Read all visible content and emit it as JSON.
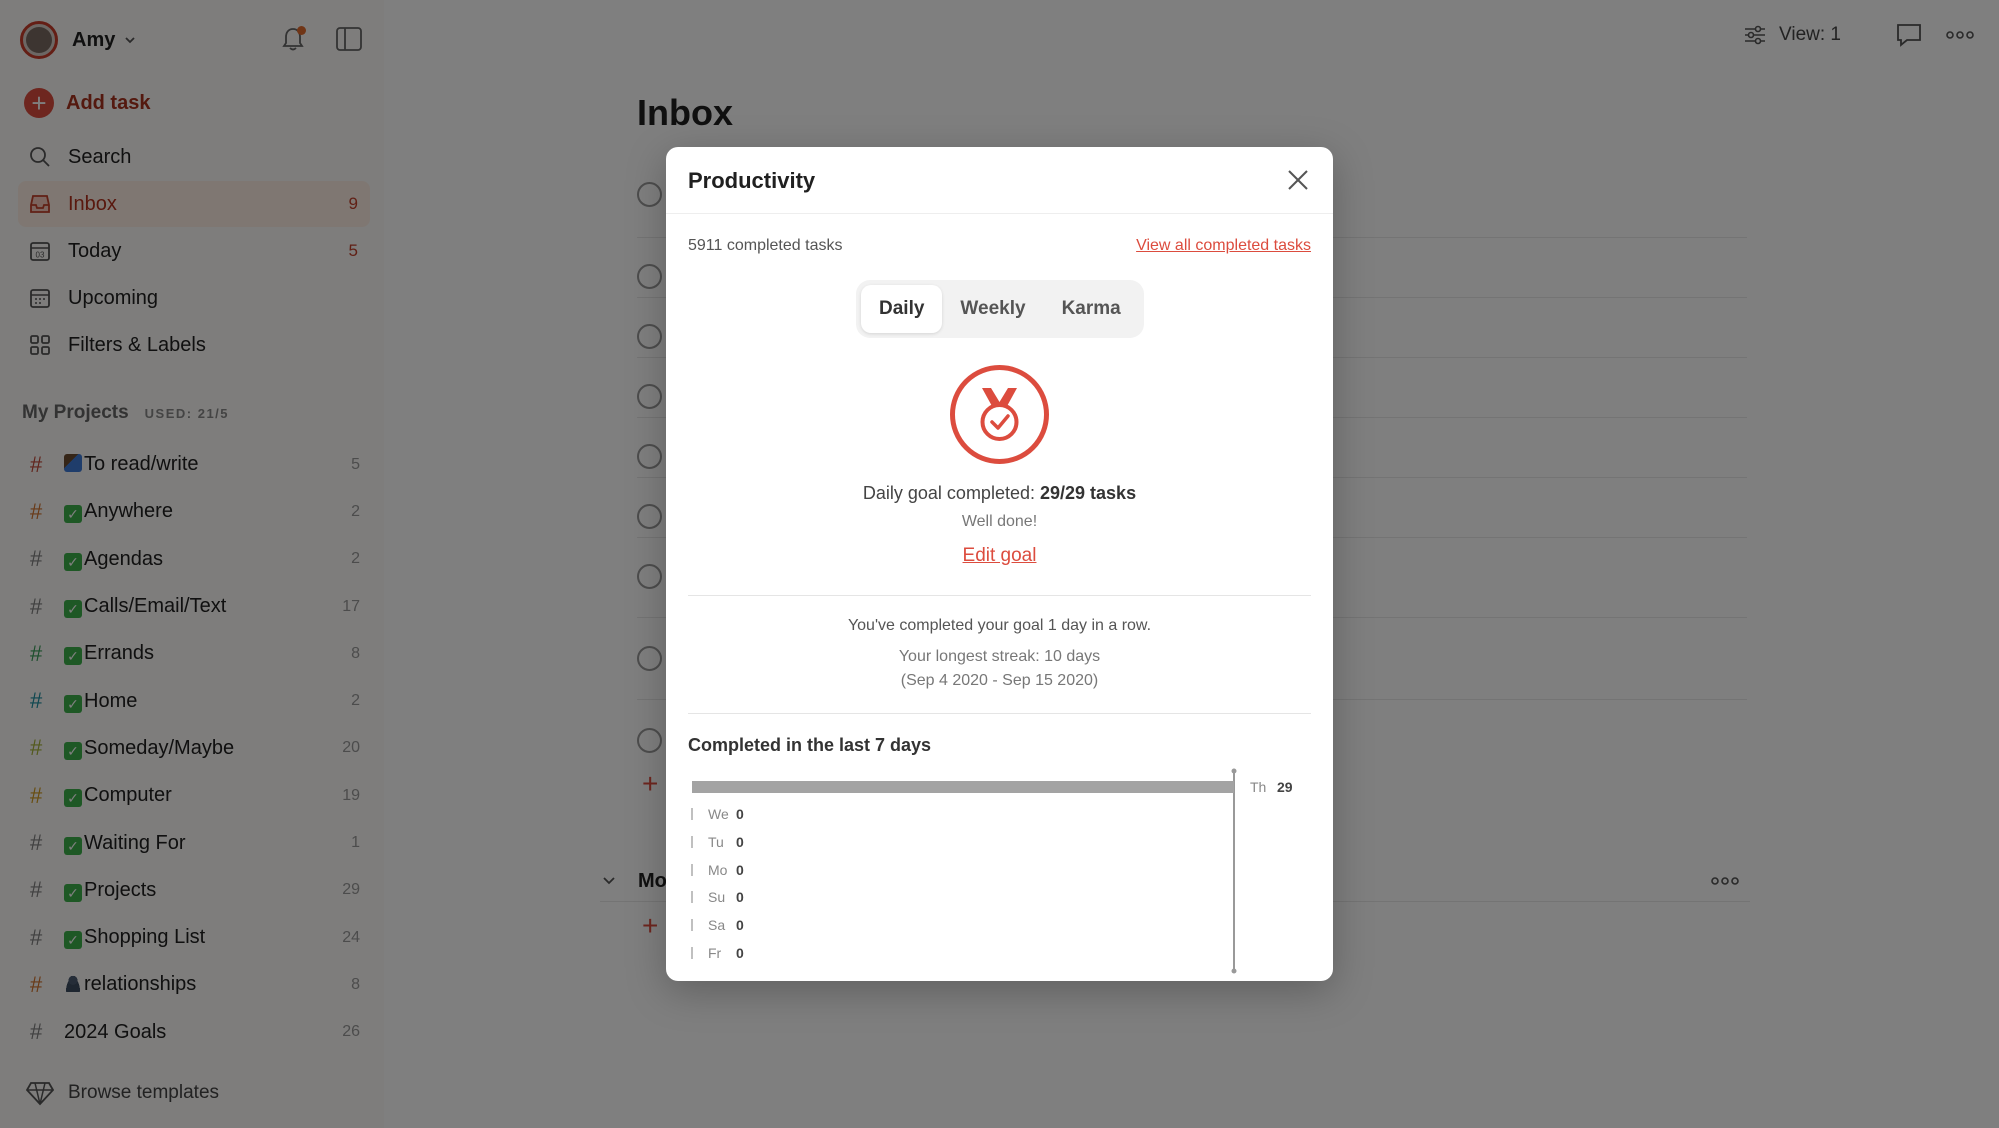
{
  "user": {
    "name": "Amy"
  },
  "sidebar": {
    "add_task": "Add task",
    "nav": [
      {
        "label": "Search",
        "count": ""
      },
      {
        "label": "Inbox",
        "count": "9"
      },
      {
        "label": "Today",
        "count": "5"
      },
      {
        "label": "Upcoming",
        "count": ""
      },
      {
        "label": "Filters & Labels",
        "count": ""
      }
    ],
    "projects_title": "My Projects",
    "projects_used": "USED: 21/5",
    "projects": [
      {
        "name": "To read/write",
        "count": "5",
        "hash_color": "#c24a3a",
        "emoji": "book"
      },
      {
        "name": "Anywhere",
        "count": "2",
        "hash_color": "#d2742e",
        "emoji": "check"
      },
      {
        "name": "Agendas",
        "count": "2",
        "hash_color": "#808080",
        "emoji": "check"
      },
      {
        "name": "Calls/Email/Text",
        "count": "17",
        "hash_color": "#808080",
        "emoji": "check"
      },
      {
        "name": "Errands",
        "count": "8",
        "hash_color": "#3a9e5a",
        "emoji": "check"
      },
      {
        "name": "Home",
        "count": "2",
        "hash_color": "#1d8fa0",
        "emoji": "check"
      },
      {
        "name": "Someday/Maybe",
        "count": "20",
        "hash_color": "#a7b43a",
        "emoji": "check"
      },
      {
        "name": "Computer",
        "count": "19",
        "hash_color": "#d19a1e",
        "emoji": "check"
      },
      {
        "name": "Waiting For",
        "count": "1",
        "hash_color": "#808080",
        "emoji": "check"
      },
      {
        "name": "Projects",
        "count": "29",
        "hash_color": "#808080",
        "emoji": "check"
      },
      {
        "name": "Shopping List",
        "count": "24",
        "hash_color": "#808080",
        "emoji": "check"
      },
      {
        "name": "relationships",
        "count": "8",
        "hash_color": "#d2742e",
        "emoji": "people"
      },
      {
        "name": "2024 Goals",
        "count": "26",
        "hash_color": "#808080",
        "emoji": ""
      }
    ],
    "browse_templates": "Browse templates"
  },
  "toolbar": {
    "view_label": "View: 1"
  },
  "main": {
    "title": "Inbox",
    "section_title": "Mo"
  },
  "modal": {
    "title": "Productivity",
    "completed_count": "5911 completed tasks",
    "view_all": "View all completed tasks",
    "tabs": [
      {
        "label": "Daily",
        "active": true
      },
      {
        "label": "Weekly",
        "active": false
      },
      {
        "label": "Karma",
        "active": false
      }
    ],
    "goal_prefix": "Daily goal completed:",
    "goal_value": "29/29 tasks",
    "well_done": "Well done!",
    "edit_goal": "Edit goal",
    "streak_line": "You've completed your goal 1 day in a row.",
    "longest_streak": "Your longest streak: 10 days",
    "longest_range": "(Sep 4 2020 - Sep 15 2020)",
    "chart_title": "Completed in the last 7 days"
  },
  "colors": {
    "accent": "#dc4c3e",
    "inbox_active_bg": "#ffefe5"
  },
  "chart_data": {
    "type": "bar",
    "orientation": "horizontal",
    "title": "Completed in the last 7 days",
    "categories": [
      "Th",
      "We",
      "Tu",
      "Mo",
      "Su",
      "Sa",
      "Fr"
    ],
    "values": [
      29,
      0,
      0,
      0,
      0,
      0,
      0
    ],
    "xlim": [
      0,
      29
    ],
    "grid": false
  }
}
